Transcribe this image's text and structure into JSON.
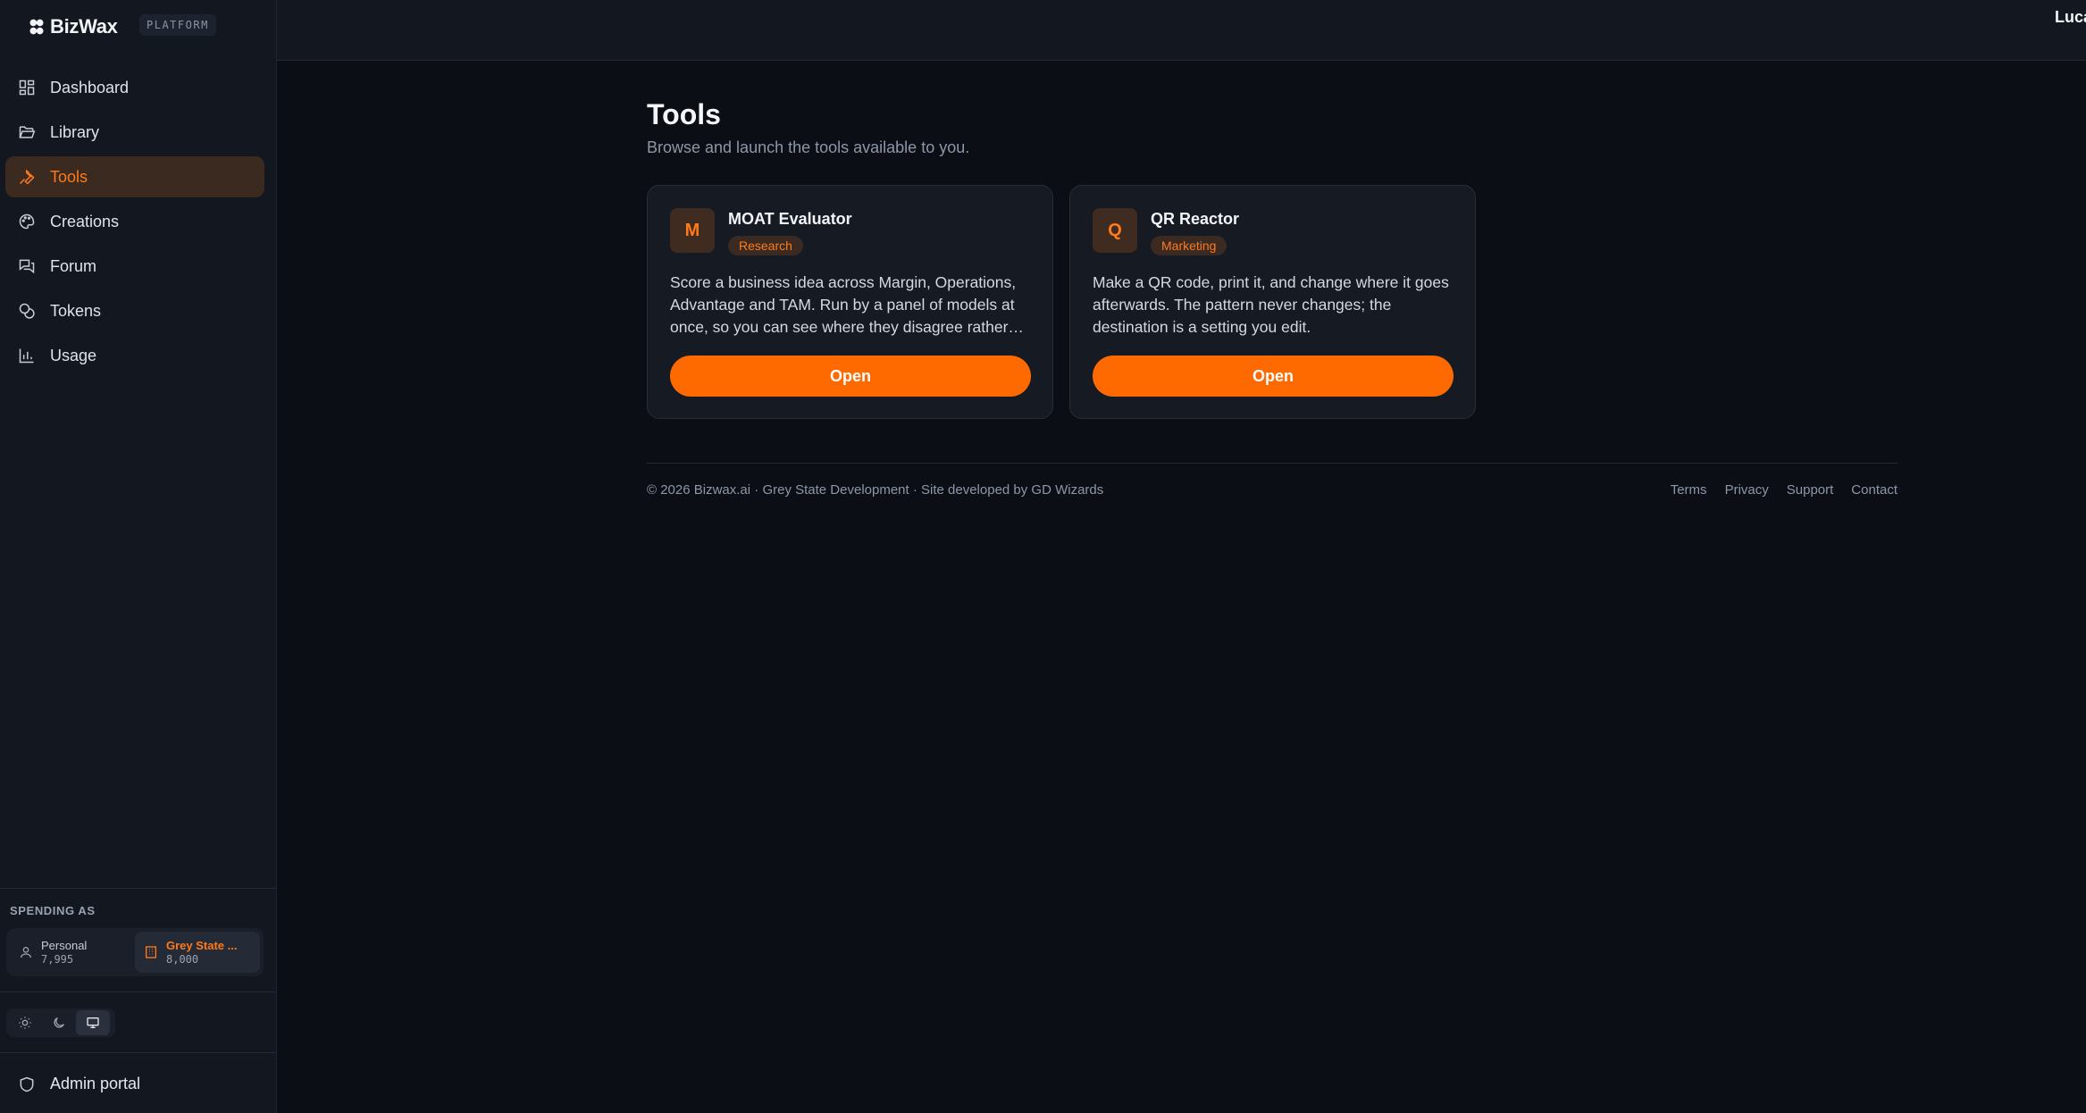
{
  "brand": {
    "name": "BizWax",
    "badge": "PLATFORM"
  },
  "sidebar": {
    "items": [
      {
        "label": "Dashboard",
        "icon": "dashboard-icon"
      },
      {
        "label": "Library",
        "icon": "folder-icon"
      },
      {
        "label": "Tools",
        "icon": "wrench-icon",
        "active": true
      },
      {
        "label": "Creations",
        "icon": "palette-icon"
      },
      {
        "label": "Forum",
        "icon": "chat-icon"
      },
      {
        "label": "Tokens",
        "icon": "coins-icon"
      },
      {
        "label": "Usage",
        "icon": "bar-chart-icon"
      }
    ],
    "spending_label": "SPENDING AS",
    "spending": [
      {
        "name": "Personal",
        "amount": "7,995"
      },
      {
        "name": "Grey State ...",
        "amount": "8,000",
        "active": true
      }
    ],
    "theme": [
      "sun-icon",
      "moon-icon",
      "monitor-icon"
    ],
    "admin_label": "Admin portal"
  },
  "topbar": {
    "user": "Luca"
  },
  "main": {
    "title": "Tools",
    "subtitle": "Browse and launch the tools available to you.",
    "cards": [
      {
        "initial": "M",
        "title": "MOAT Evaluator",
        "tag": "Research",
        "description": "Score a business idea across Margin, Operations, Advantage and TAM. Run by a panel of models at once, so you can see where they disagree rather…",
        "button": "Open"
      },
      {
        "initial": "Q",
        "title": "QR Reactor",
        "tag": "Marketing",
        "description": "Make a QR code, print it, and change where it goes afterwards. The pattern never changes; the destination is a setting you edit.",
        "button": "Open"
      }
    ]
  },
  "footer": {
    "copyright": "© 2026 Bizwax.ai · Grey State Development · Site developed by GD Wizards",
    "links": [
      "Terms",
      "Privacy",
      "Support",
      "Contact"
    ]
  },
  "colors": {
    "accent": "#ff6a00",
    "background": "#0b0e14",
    "sidebar": "#121720"
  }
}
